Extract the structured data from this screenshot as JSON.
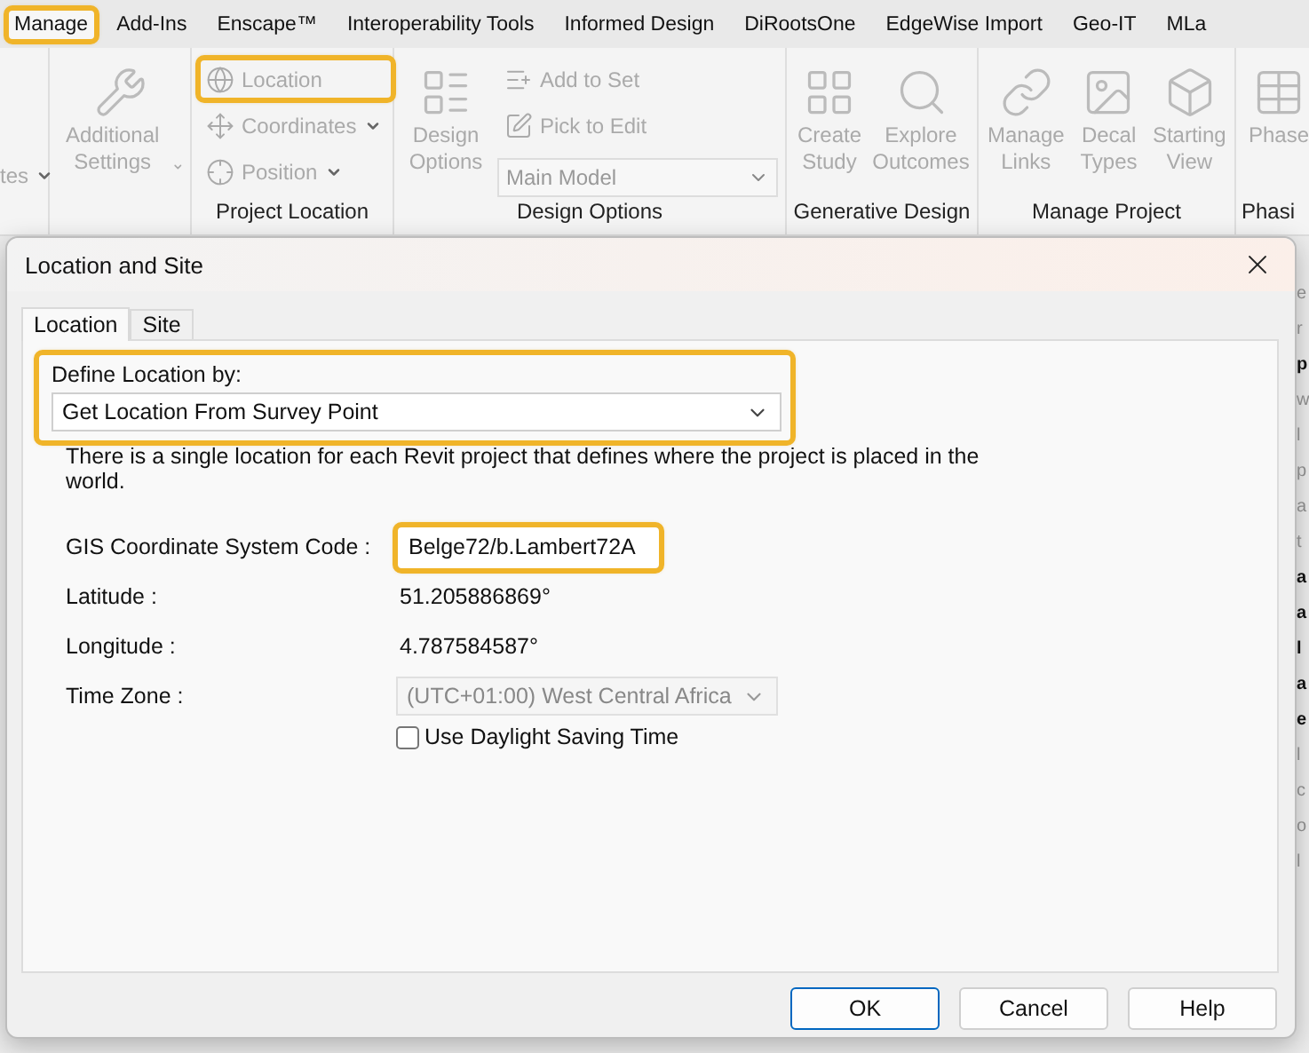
{
  "ribbon_tabs": [
    {
      "label": "Manage",
      "selected": true,
      "highlighted": true
    },
    {
      "label": "Add-Ins",
      "selected": false,
      "highlighted": false
    },
    {
      "label": "Enscape™",
      "selected": false,
      "highlighted": false
    },
    {
      "label": "Interoperability Tools",
      "selected": false,
      "highlighted": false
    },
    {
      "label": "Informed Design",
      "selected": false,
      "highlighted": false
    },
    {
      "label": "DiRootsOne",
      "selected": false,
      "highlighted": false
    },
    {
      "label": "EdgeWise Import",
      "selected": false,
      "highlighted": false
    },
    {
      "label": "Geo-IT",
      "selected": false,
      "highlighted": false
    },
    {
      "label": "MLa",
      "selected": false,
      "highlighted": false
    }
  ],
  "ribbon_groups": [
    {
      "items": [
        {
          "kind": "small",
          "label": "tes",
          "dropdown": true,
          "highlighted": false
        }
      ]
    },
    {
      "items": [
        {
          "kind": "large",
          "label": "Additional Settings",
          "dropdown": true
        }
      ]
    },
    {
      "label": "Project Location",
      "items": [
        {
          "kind": "small",
          "label": "Location",
          "dropdown": false,
          "highlighted": true
        },
        {
          "kind": "small",
          "label": "Coordinates",
          "dropdown": true,
          "highlighted": false
        },
        {
          "kind": "small",
          "label": "Position",
          "dropdown": true,
          "highlighted": false
        }
      ]
    },
    {
      "label": "Design Options",
      "items": [
        {
          "kind": "large",
          "label": "Design Options",
          "dropdown": false
        },
        {
          "kind": "small",
          "label": "Add to Set",
          "dropdown": false,
          "highlighted": false
        },
        {
          "kind": "small",
          "label": "Pick to Edit",
          "dropdown": false,
          "highlighted": false
        },
        {
          "kind": "select",
          "label": "Main Model"
        }
      ]
    },
    {
      "label": "Generative Design",
      "items": [
        {
          "kind": "large",
          "label": "Create Study",
          "dropdown": false
        },
        {
          "kind": "large",
          "label": "Explore Outcomes",
          "dropdown": false
        }
      ]
    },
    {
      "label": "Manage Project",
      "items": [
        {
          "kind": "large",
          "label": "Manage Links",
          "dropdown": false
        },
        {
          "kind": "large",
          "label": "Decal Types",
          "dropdown": false
        },
        {
          "kind": "large",
          "label": "Starting View",
          "dropdown": false
        }
      ]
    },
    {
      "label": "Phasi",
      "items": [
        {
          "kind": "large",
          "label": "Phase",
          "dropdown": false
        }
      ]
    }
  ],
  "side_fragments": [
    {
      "text": "e",
      "bold": false
    },
    {
      "text": "r",
      "bold": false
    },
    {
      "text": "p",
      "bold": true
    },
    {
      "text": "w",
      "bold": false
    },
    {
      "text": "l",
      "bold": false
    },
    {
      "text": "p",
      "bold": false
    },
    {
      "text": "a",
      "bold": false
    },
    {
      "text": "t",
      "bold": false
    },
    {
      "text": "a",
      "bold": true
    },
    {
      "text": "a",
      "bold": true
    },
    {
      "text": "l",
      "bold": true
    },
    {
      "text": "a",
      "bold": true
    },
    {
      "text": "e",
      "bold": true
    },
    {
      "text": "l",
      "bold": false
    },
    {
      "text": "c",
      "bold": false
    },
    {
      "text": "o",
      "bold": false
    },
    {
      "text": "l",
      "bold": false
    }
  ],
  "dialog": {
    "title": "Location and Site",
    "tabs": [
      {
        "label": "Location",
        "selected": true
      },
      {
        "label": "Site",
        "selected": false
      }
    ],
    "define_location": {
      "label": "Define Location by:",
      "value": "Get Location From Survey Point",
      "highlighted": true
    },
    "description": "There is a single location for each Revit project that defines where the project is placed in the world.",
    "fields": [
      {
        "kind": "input",
        "label": "GIS Coordinate System Code :",
        "value": "Belge72/b.Lambert72A",
        "highlighted": true
      },
      {
        "kind": "text",
        "label": "Latitude :",
        "value": "51.205886869°"
      },
      {
        "kind": "text",
        "label": "Longitude :",
        "value": "4.787584587°"
      },
      {
        "kind": "select",
        "label": "Time Zone :",
        "value": "(UTC+01:00) West Central Africa",
        "disabled": true
      }
    ],
    "daylight_saving": {
      "label": "Use Daylight Saving Time",
      "checked": false
    },
    "buttons": [
      {
        "label": "OK",
        "default": true
      },
      {
        "label": "Cancel",
        "default": false
      },
      {
        "label": "Help",
        "default": false
      }
    ]
  }
}
